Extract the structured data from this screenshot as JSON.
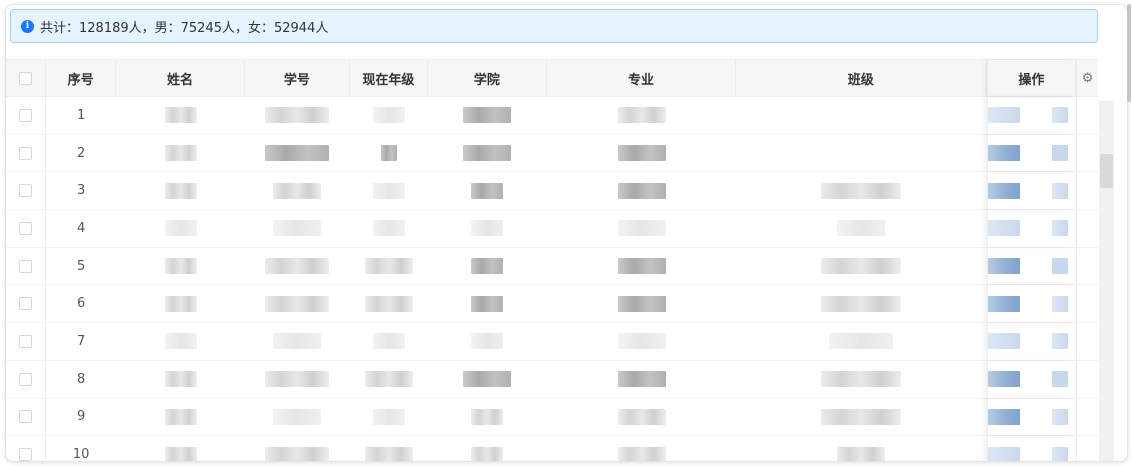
{
  "summary": {
    "icon": "info-icon",
    "text": "共计：128189人，男：75245人，女：52944人"
  },
  "table": {
    "headers": {
      "index": "序号",
      "name": "姓名",
      "student_id": "学号",
      "grade": "现在年级",
      "college": "学院",
      "major": "专业",
      "class": "班级",
      "actions": "操作"
    },
    "rows": [
      {
        "index": "1"
      },
      {
        "index": "2"
      },
      {
        "index": "3"
      },
      {
        "index": "4"
      },
      {
        "index": "5"
      },
      {
        "index": "6"
      },
      {
        "index": "7"
      },
      {
        "index": "8"
      },
      {
        "index": "9"
      },
      {
        "index": "10"
      }
    ]
  },
  "colors": {
    "alert_bg": "#e6f4ff",
    "alert_border": "#9fd3fb",
    "info_icon": "#1677ff",
    "header_bg": "#f6f6f6"
  }
}
